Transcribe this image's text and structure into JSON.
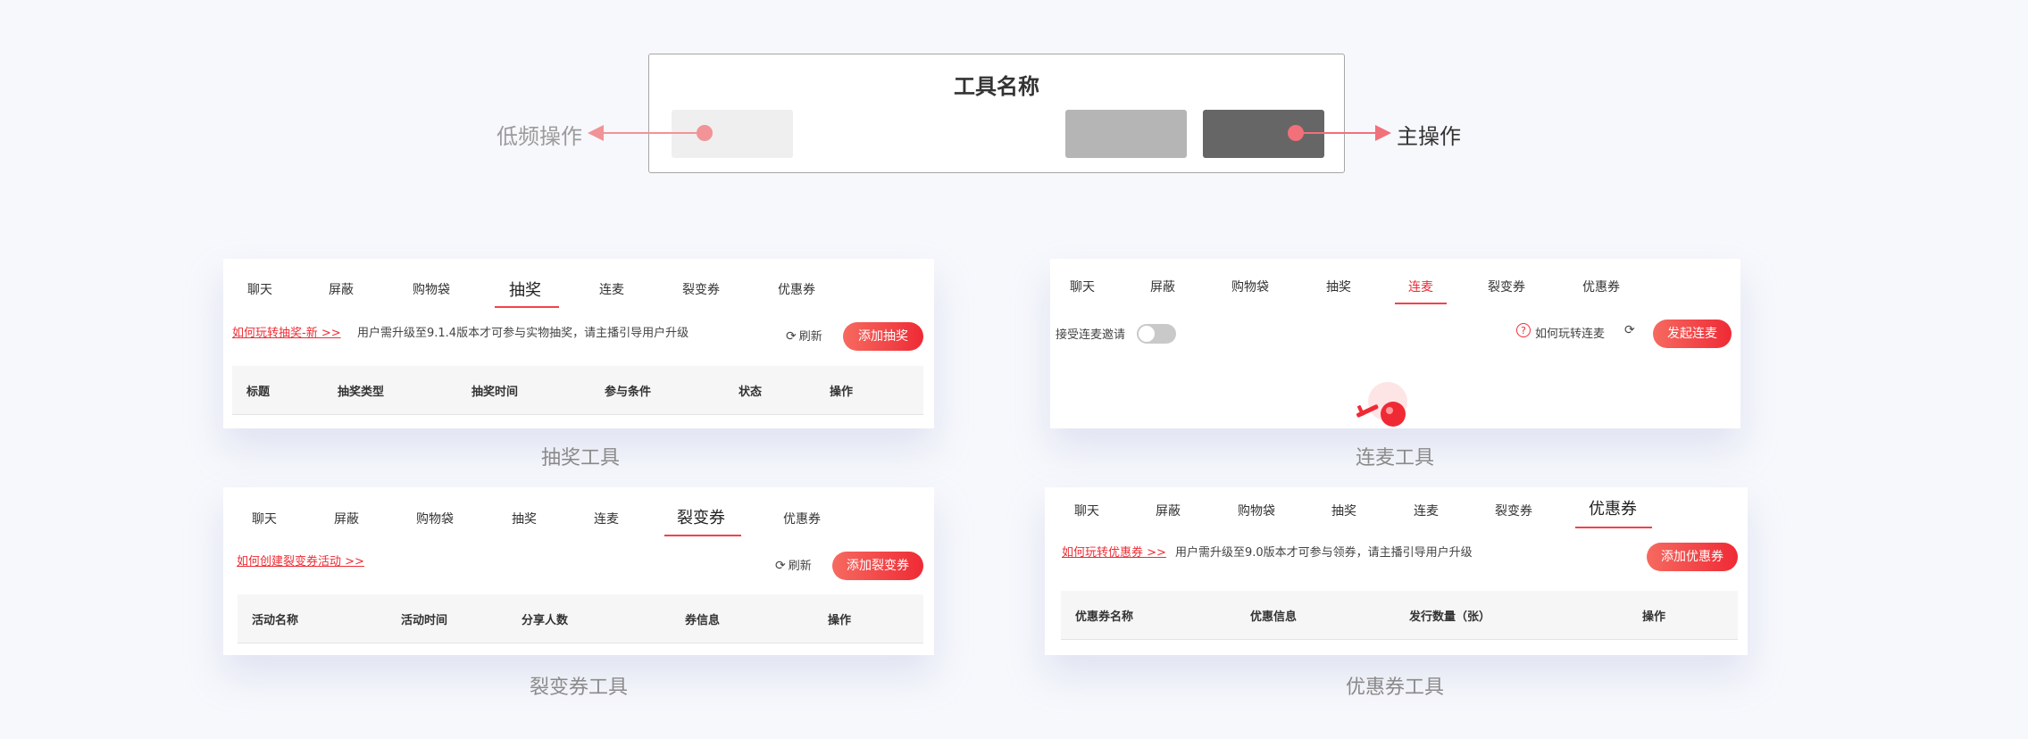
{
  "diagram": {
    "title": "工具名称",
    "low_label": "低频操作",
    "main_label": "主操作"
  },
  "lottery": {
    "tabs": [
      "聊天",
      "屏蔽",
      "购物袋",
      "抽奖",
      "连麦",
      "裂变券",
      "优惠券"
    ],
    "active_tab": "抽奖",
    "help_link": "如何玩转抽奖-新 >>",
    "note": "用户需升级至9.1.4版本才可参与实物抽奖，请主播引导用户升级",
    "refresh": "刷新",
    "add_button": "添加抽奖",
    "columns": [
      "标题",
      "抽奖类型",
      "抽奖时间",
      "参与条件",
      "状态",
      "操作"
    ],
    "caption": "抽奖工具"
  },
  "mic": {
    "tabs": [
      "聊天",
      "屏蔽",
      "购物袋",
      "抽奖",
      "连麦",
      "裂变券",
      "优惠券"
    ],
    "active_tab": "连麦",
    "accept_label": "接受连麦邀请",
    "help_link": "如何玩转连麦",
    "start_button": "发起连麦",
    "caption": "连麦工具"
  },
  "fission": {
    "tabs": [
      "聊天",
      "屏蔽",
      "购物袋",
      "抽奖",
      "连麦",
      "裂变券",
      "优惠券"
    ],
    "active_tab": "裂变券",
    "help_link": "如何创建裂变券活动 >>",
    "refresh": "刷新",
    "add_button": "添加裂变券",
    "columns": [
      "活动名称",
      "活动时间",
      "分享人数",
      "券信息",
      "操作"
    ],
    "caption": "裂变券工具"
  },
  "coupon": {
    "tabs": [
      "聊天",
      "屏蔽",
      "购物袋",
      "抽奖",
      "连麦",
      "裂变券",
      "优惠券"
    ],
    "active_tab": "优惠券",
    "help_link": "如何玩转优惠券 >>",
    "note": "用户需升级至9.0版本才可参与领券，请主播引导用户升级",
    "add_button": "添加优惠券",
    "columns": [
      "优惠券名称",
      "优惠信息",
      "发行数量（张）",
      "操作"
    ],
    "caption": "优惠券工具"
  },
  "colors": {
    "accent": "#ef2a35",
    "arrow": "#f19397",
    "background": "#f7f8fc"
  }
}
